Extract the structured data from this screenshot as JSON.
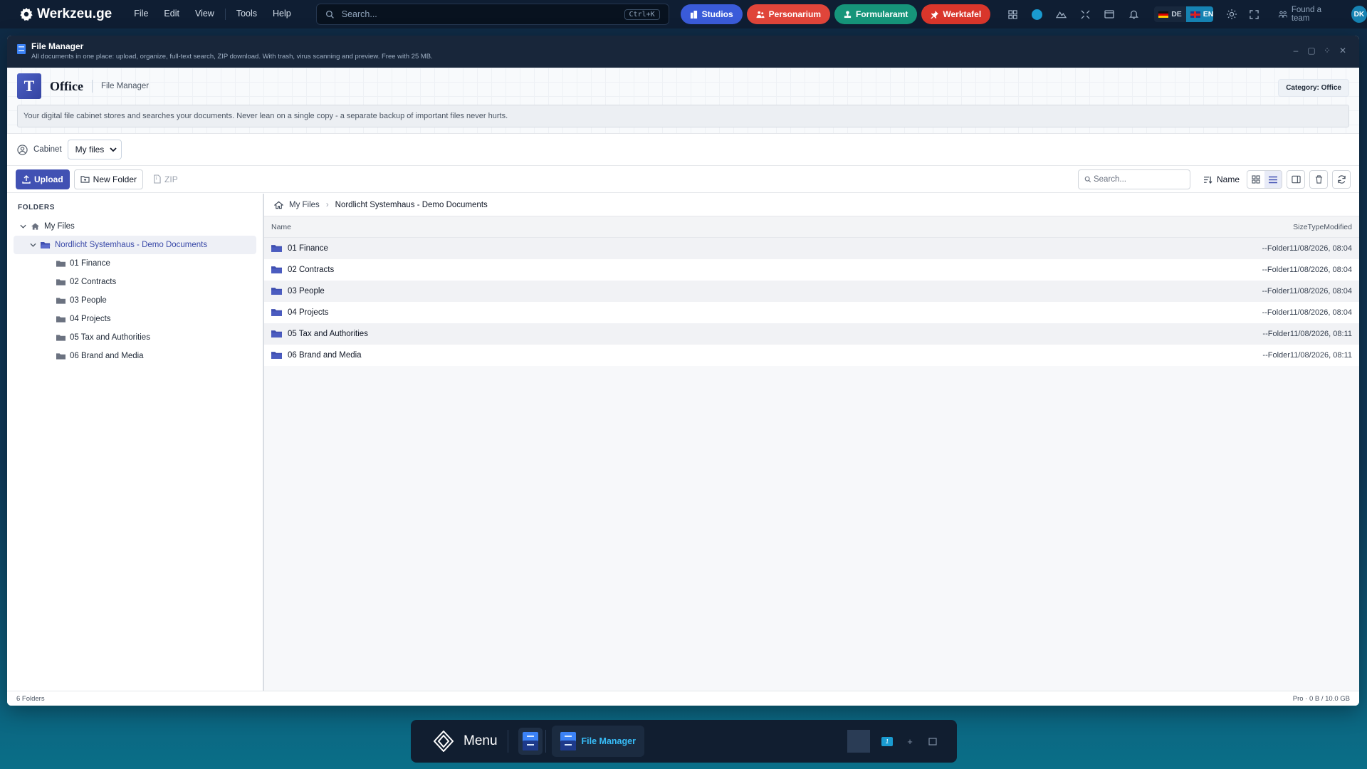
{
  "topbar": {
    "brand": "Werkzeu.ge",
    "menu": [
      "File",
      "Edit",
      "View",
      "Tools",
      "Help"
    ],
    "search_placeholder": "Search...",
    "search_shortcut": "Ctrl+K",
    "pills": [
      {
        "label": "Studios",
        "color": "#3a5bd9"
      },
      {
        "label": "Personarium",
        "color": "#e0453a"
      },
      {
        "label": "Formularamt",
        "color": "#16957a"
      },
      {
        "label": "Werktafel",
        "color": "#d9362b"
      }
    ],
    "lang_de": "DE",
    "lang_en": "EN",
    "found_team": "Found a team",
    "avatar_initials": "DK"
  },
  "window": {
    "title": "File Manager",
    "subtitle": "All documents in one place: upload, organize, full-text search, ZIP download. With trash, virus scanning and preview. Free with 25 MB."
  },
  "app": {
    "logo_letter": "T",
    "title": "Office",
    "subtitle": "File Manager",
    "category": "Category: Office",
    "info": "Your digital file cabinet stores and searches your documents. Never lean on a single copy - a separate backup of important files never hurts."
  },
  "cabinet": {
    "label": "Cabinet",
    "selected": "My files"
  },
  "toolbar": {
    "upload": "Upload",
    "new_folder": "New Folder",
    "zip": "ZIP",
    "search_placeholder": "Search...",
    "sort": "Name"
  },
  "sidebar": {
    "title": "FOLDERS",
    "root": "My Files",
    "selected": "Nordlicht Systemhaus - Demo Documents",
    "children": [
      "01 Finance",
      "02 Contracts",
      "03 People",
      "04 Projects",
      "05 Tax and Authorities",
      "06 Brand and Media"
    ]
  },
  "breadcrumb": {
    "root": "My Files",
    "current": "Nordlicht Systemhaus - Demo Documents"
  },
  "table": {
    "col_name": "Name",
    "col_meta": "SizeTypeModified",
    "rows": [
      {
        "name": "01 Finance",
        "meta": "--Folder11/08/2026, 08:04"
      },
      {
        "name": "02 Contracts",
        "meta": "--Folder11/08/2026, 08:04"
      },
      {
        "name": "03 People",
        "meta": "--Folder11/08/2026, 08:04"
      },
      {
        "name": "04 Projects",
        "meta": "--Folder11/08/2026, 08:04"
      },
      {
        "name": "05 Tax and Authorities",
        "meta": "--Folder11/08/2026, 08:11"
      },
      {
        "name": "06 Brand and Media",
        "meta": "--Folder11/08/2026, 08:11"
      }
    ]
  },
  "status": {
    "left": "6 Folders",
    "right": "Pro · 0 B / 10.0 GB"
  },
  "taskbar": {
    "menu": "Menu",
    "active_app": "File Manager",
    "workspace": "1"
  },
  "colors": {
    "accent": "#4151b3",
    "folder": "#3f4fb0",
    "highlight": "#38bdf8"
  }
}
